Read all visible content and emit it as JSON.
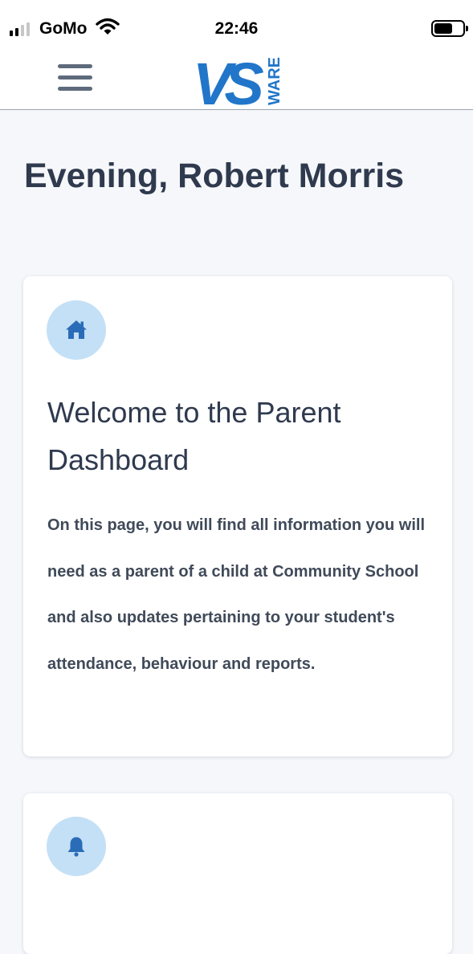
{
  "status_bar": {
    "carrier": "GoMo",
    "time": "22:46",
    "signal_bars_active": 2,
    "signal_bars_total": 4,
    "battery_level": 0.6,
    "icons": [
      "signal-icon",
      "wifi-icon",
      "battery-icon"
    ]
  },
  "header": {
    "menu_icon": "hamburger-menu-icon",
    "logo": {
      "letters": "VS",
      "side_text": "WARE",
      "color": "#2276c9"
    }
  },
  "greeting": "Evening, Robert Morris",
  "cards": [
    {
      "icon": "home-icon",
      "title": "Welcome to the Parent Dashboard",
      "body": "On this page, you will find all information you will need as a parent of a child at Community School and also updates pertaining to your student's attendance, behaviour and reports."
    },
    {
      "icon": "bell-icon"
    }
  ],
  "colors": {
    "accent": "#2276c9",
    "icon_bg": "#c3e0f6",
    "page_bg": "#f5f7fa",
    "text_dark": "#2f3a4e"
  }
}
